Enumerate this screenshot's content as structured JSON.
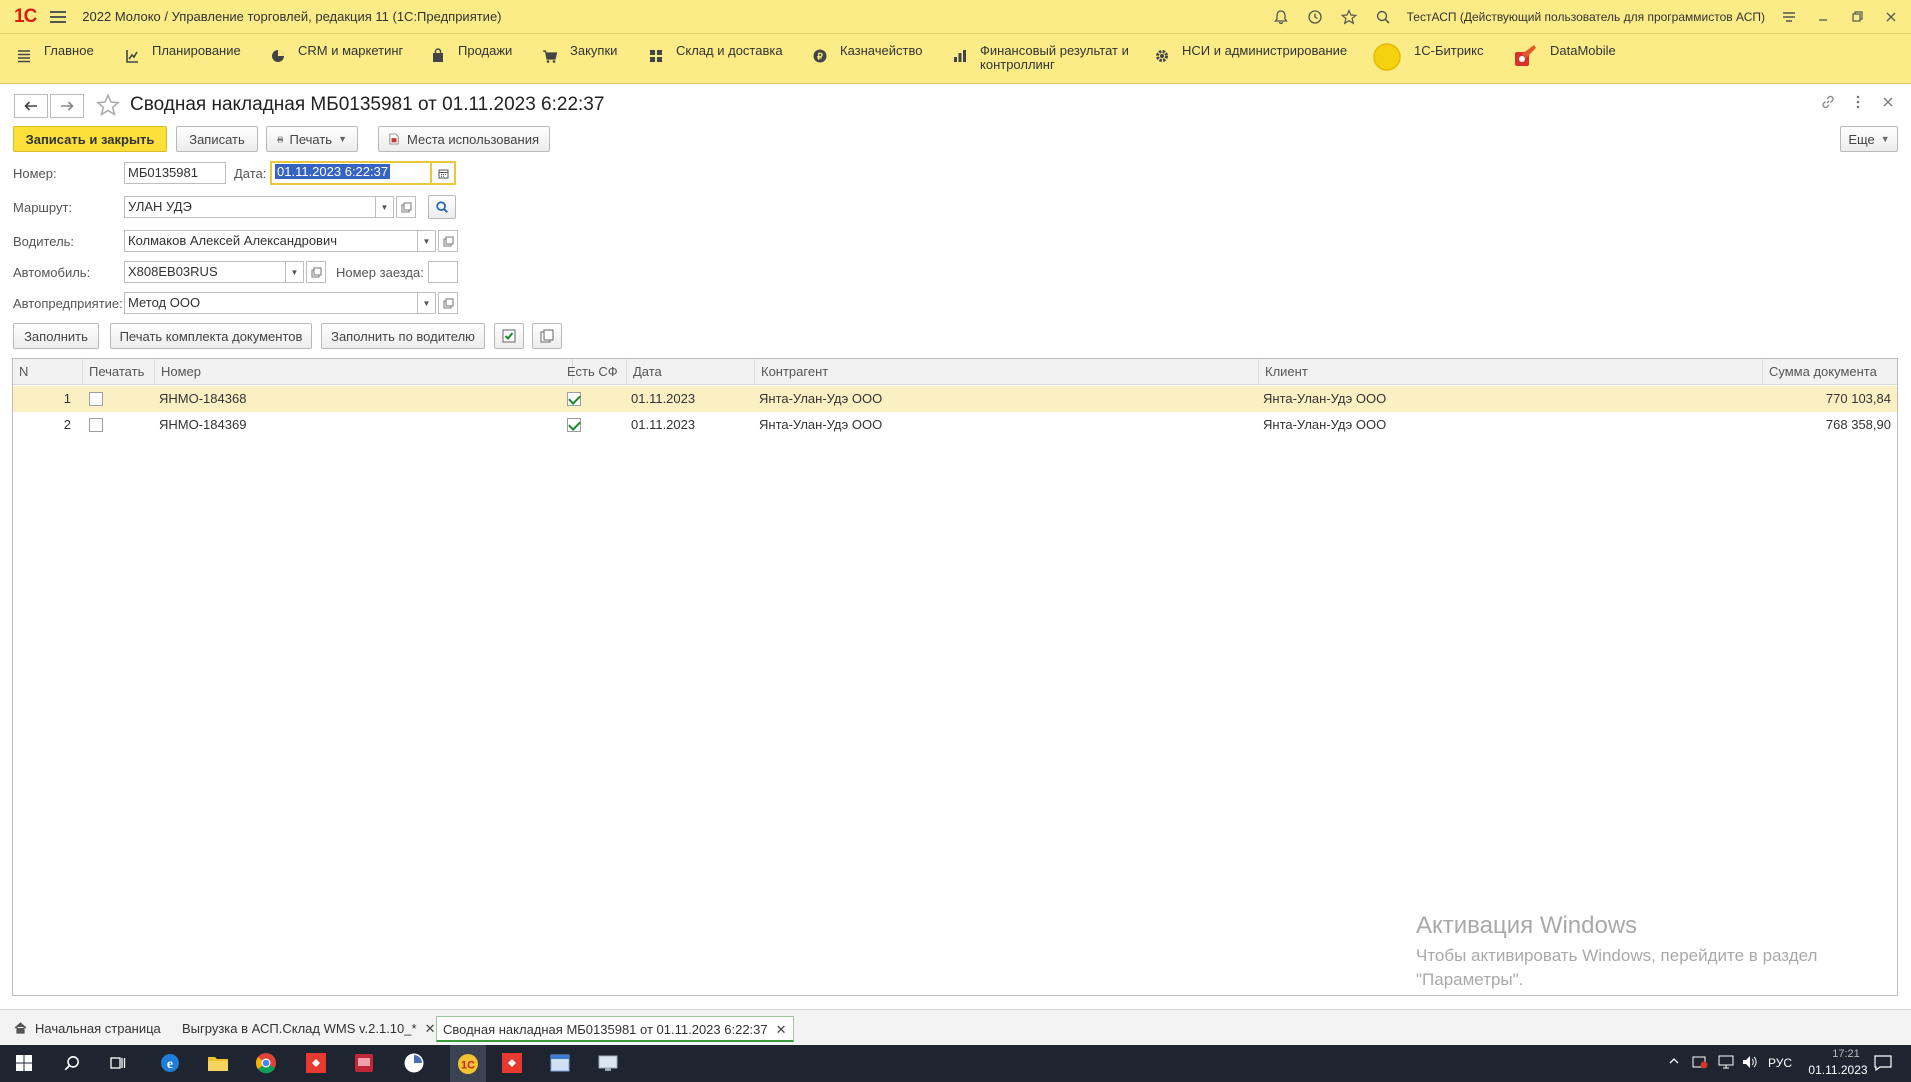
{
  "app": {
    "title": "2022 Молоко / Управление торговлей, редакция 11  (1С:Предприятие)",
    "user": "ТестАСП (Действующий пользователь для программистов АСП)"
  },
  "sections": [
    {
      "label": "Главное",
      "icon": "menu-lines-icon"
    },
    {
      "label": "Планирование",
      "icon": "planning-icon"
    },
    {
      "label": "CRM и маркетинг",
      "icon": "pie-icon"
    },
    {
      "label": "Продажи",
      "icon": "bag-icon"
    },
    {
      "label": "Закупки",
      "icon": "cart-icon"
    },
    {
      "label": "Склад и доставка",
      "icon": "grid-icon"
    },
    {
      "label": "Казначейство",
      "icon": "coin-icon"
    },
    {
      "label": "Финансовый результат и контроллинг",
      "icon": "bars-icon"
    },
    {
      "label": "НСИ и администрирование",
      "icon": "gear-icon"
    },
    {
      "label": "1С-Битрикс",
      "icon": "bitrix-icon"
    },
    {
      "label": "DataMobile",
      "icon": "datamobile-icon"
    }
  ],
  "form": {
    "title": "Сводная накладная МБ0135981 от 01.11.2023 6:22:37",
    "buttons": {
      "save_close": "Записать и закрыть",
      "save": "Записать",
      "print": "Печать",
      "usage": "Места использования",
      "more": "Еще"
    },
    "fields": {
      "number_label": "Номер:",
      "number_value": "МБ0135981",
      "date_label": "Дата:",
      "date_value": "01.11.2023  6:22:37",
      "route_label": "Маршрут:",
      "route_value": "УЛАН УДЭ",
      "driver_label": "Водитель:",
      "driver_value": "Колмаков Алексей Александрович",
      "car_label": "Автомобиль:",
      "car_value": "Х808ЕВ03RUS",
      "trip_label": "Номер заезда:",
      "trip_value": "",
      "company_label": "Автопредприятие:",
      "company_value": "Метод ООО"
    },
    "table_buttons": {
      "fill": "Заполнить",
      "print_set": "Печать комплекта документов",
      "fill_driver": "Заполнить по водителю"
    }
  },
  "table": {
    "columns": [
      "N",
      "Печатать",
      "Номер",
      "Есть СФ",
      "Дата",
      "Контрагент",
      "Клиент",
      "Сумма документа"
    ],
    "rows": [
      {
        "n": "1",
        "print": false,
        "number": "ЯНМО-184368",
        "sf": true,
        "date": "01.11.2023",
        "counterparty": "Янта-Улан-Удэ ООО",
        "client": "Янта-Улан-Удэ ООО",
        "sum": "770 103,84"
      },
      {
        "n": "2",
        "print": false,
        "number": "ЯНМО-184369",
        "sf": true,
        "date": "01.11.2023",
        "counterparty": "Янта-Улан-Удэ ООО",
        "client": "Янта-Улан-Удэ ООО",
        "sum": "768 358,90"
      }
    ]
  },
  "watermark": {
    "title": "Активация Windows",
    "line1": "Чтобы активировать Windows, перейдите в раздел",
    "line2": "\"Параметры\"."
  },
  "open_windows": [
    {
      "label": "Начальная страница"
    },
    {
      "label": "Выгрузка в АСП.Склад WMS v.2.1.10_*"
    },
    {
      "label": "Сводная накладная МБ0135981 от 01.11.2023 6:22:37"
    }
  ],
  "taskbar": {
    "lang": "РУС",
    "time": "17:21",
    "date": "01.11.2023"
  }
}
